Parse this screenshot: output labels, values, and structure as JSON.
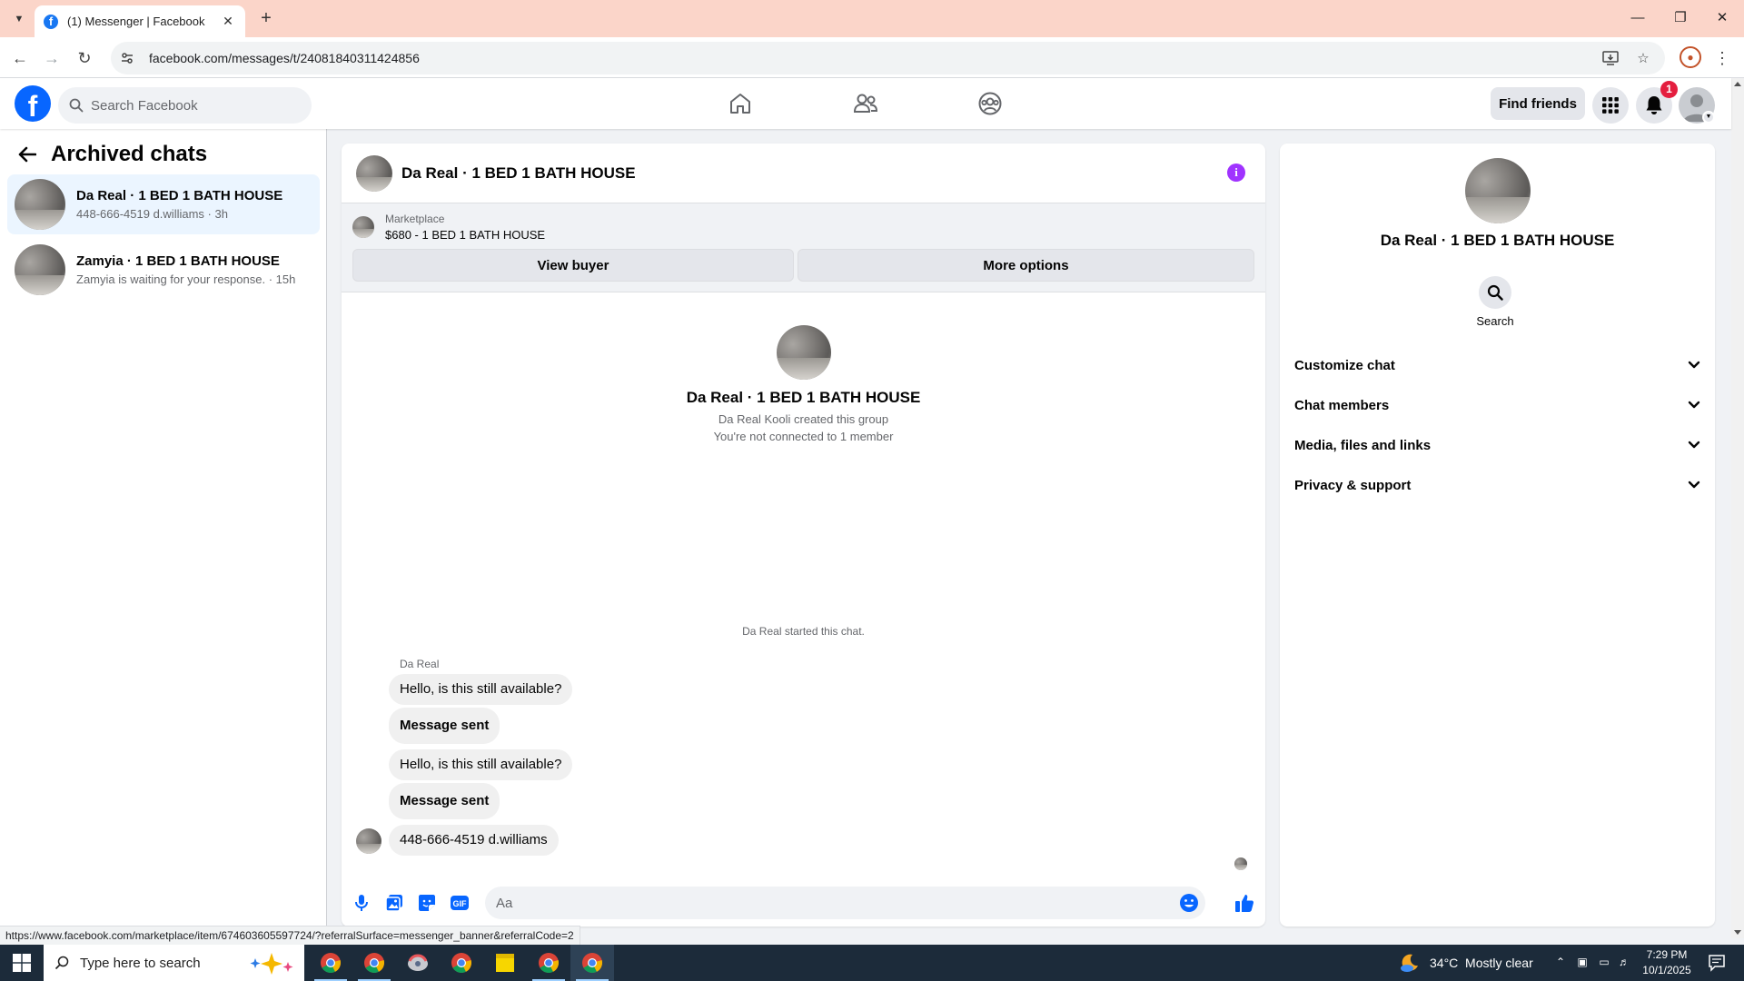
{
  "browser": {
    "tab_title": "(1) Messenger | Facebook",
    "url": "facebook.com/messages/t/24081840311424856",
    "status_url": "https://www.facebook.com/marketplace/item/674603605597724/?referralSurface=messenger_banner&referralCode=2"
  },
  "header": {
    "search_placeholder": "Search Facebook",
    "find_friends_label": "Find friends",
    "notification_count": "1"
  },
  "sidebar": {
    "title": "Archived chats",
    "chats": [
      {
        "name": "Da Real · 1 BED 1 BATH HOUSE",
        "preview": "448-666-4519 d.williams · 3h"
      },
      {
        "name": "Zamyia · 1 BED 1 BATH HOUSE",
        "preview": "Zamyia is waiting for your response. · 15h"
      }
    ]
  },
  "conversation": {
    "title": "Da Real · 1 BED 1 BATH HOUSE",
    "marketplace_label": "Marketplace",
    "listing": "$680 - 1 BED 1 BATH HOUSE",
    "view_buyer_label": "View buyer",
    "more_options_label": "More options",
    "intro_name": "Da Real · 1 BED 1 BATH HOUSE",
    "intro_created": "Da Real Kooli created this group",
    "intro_connected": "You're not connected to 1 member",
    "started_text": "Da Real started this chat.",
    "sender": "Da Real",
    "messages": [
      {
        "text": "Hello, is this still available?"
      },
      {
        "text": "Message sent"
      },
      {
        "text": "Hello, is this still available?"
      },
      {
        "text": "Message sent"
      },
      {
        "text": "448-666-4519 d.williams"
      }
    ],
    "composer_placeholder": "Aa"
  },
  "details": {
    "name": "Da Real · 1 BED 1 BATH HOUSE",
    "search_label": "Search",
    "sections": [
      "Customize chat",
      "Chat members",
      "Media, files and links",
      "Privacy & support"
    ]
  },
  "taskbar": {
    "search_placeholder": "Type here to search",
    "weather": "34°C  Mostly clear",
    "time": "7:29 PM",
    "date": "10/1/2025"
  },
  "colors": {
    "facebook_blue": "#0866ff",
    "active_chat": "#ebf5ff",
    "info_purple": "#a033ff",
    "composer_blue": "#0866ff",
    "tab_strip": "#fbd5c9"
  }
}
